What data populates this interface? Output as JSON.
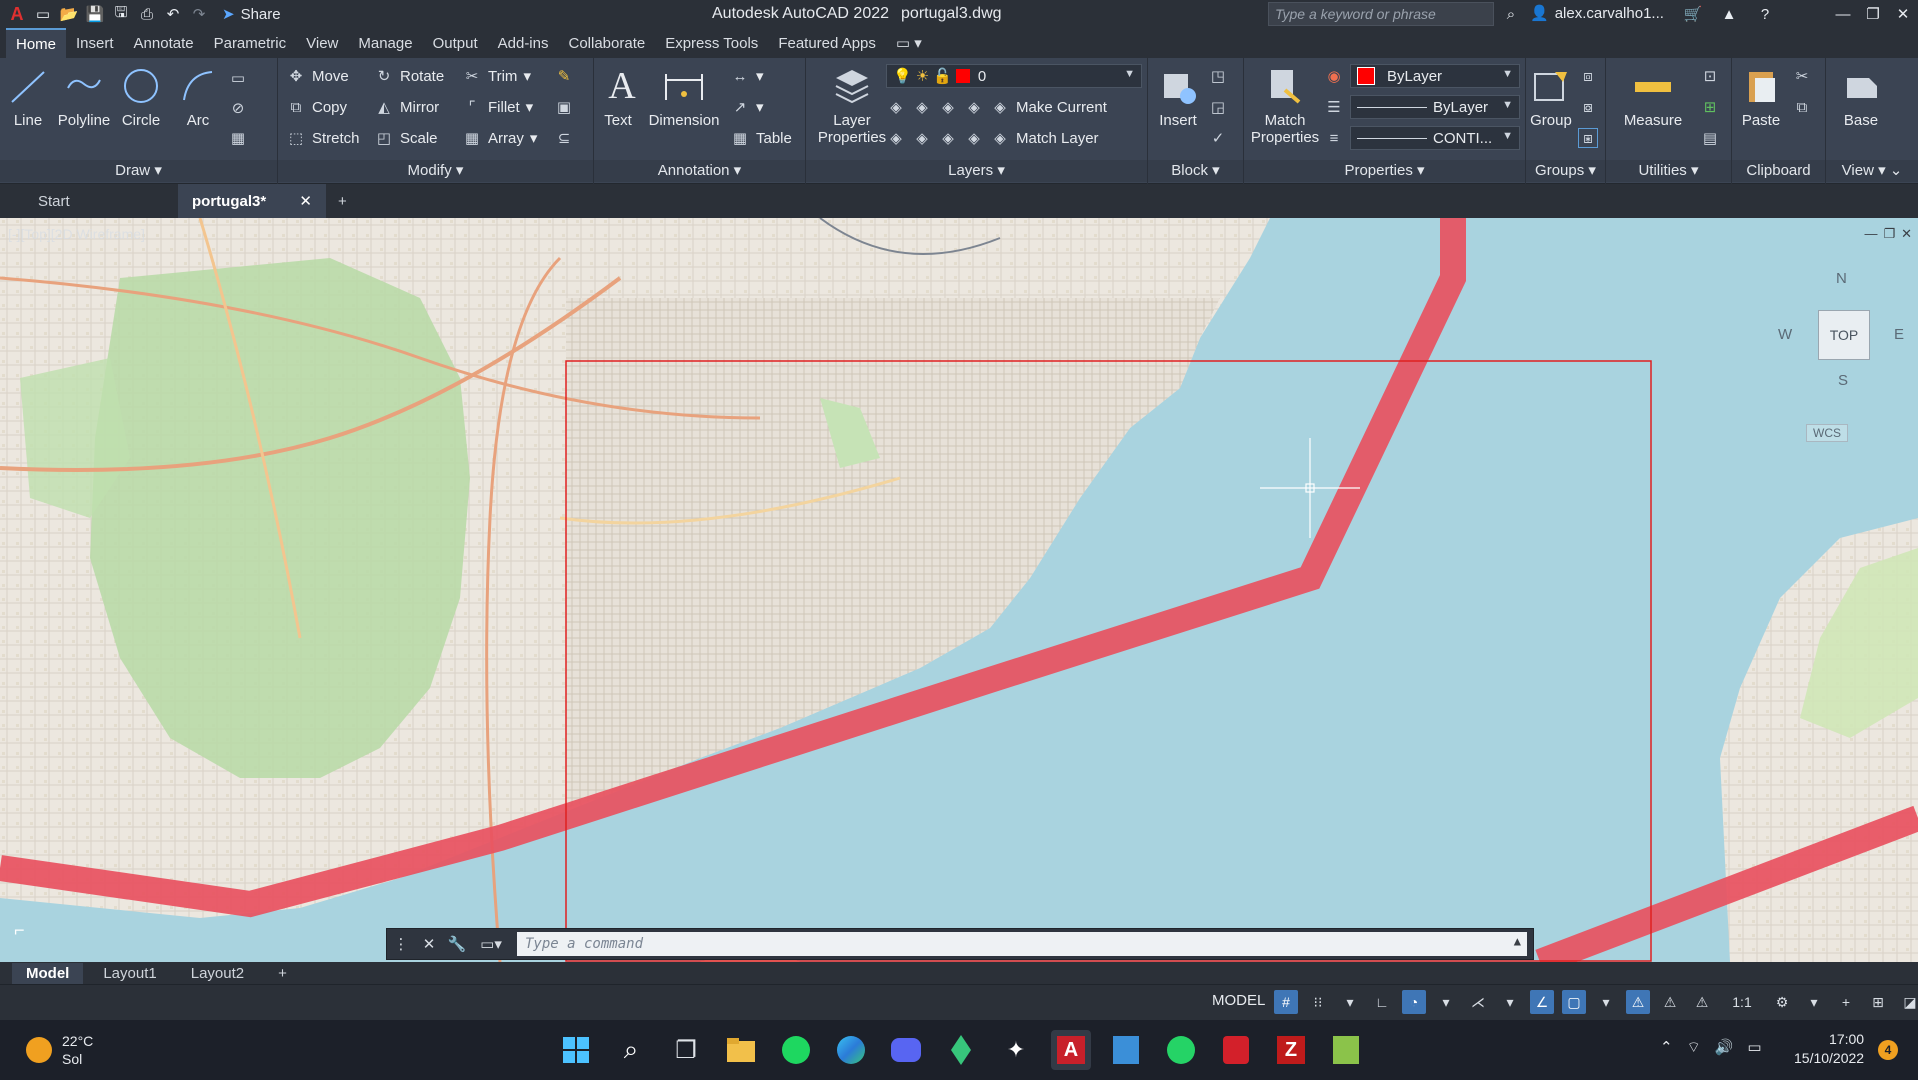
{
  "app": {
    "name": "Autodesk AutoCAD 2022",
    "file": "portugal3.dwg"
  },
  "titlebar": {
    "share_label": "Share",
    "search_placeholder": "Type a keyword or phrase",
    "user": "alex.carvalho1..."
  },
  "ribbon_tabs": [
    "Home",
    "Insert",
    "Annotate",
    "Parametric",
    "View",
    "Manage",
    "Output",
    "Add-ins",
    "Collaborate",
    "Express Tools",
    "Featured Apps"
  ],
  "draw": {
    "title": "Draw",
    "line": "Line",
    "polyline": "Polyline",
    "circle": "Circle",
    "arc": "Arc"
  },
  "modify": {
    "title": "Modify",
    "move": "Move",
    "rotate": "Rotate",
    "trim": "Trim",
    "copy": "Copy",
    "mirror": "Mirror",
    "fillet": "Fillet",
    "stretch": "Stretch",
    "scale": "Scale",
    "array": "Array"
  },
  "annotation": {
    "title": "Annotation",
    "text": "Text",
    "dimension": "Dimension",
    "table": "Table"
  },
  "layers": {
    "title": "Layers",
    "layer_properties_1": "Layer",
    "layer_properties_2": "Properties",
    "current_layer": "0",
    "make_current": "Make Current",
    "match_layer": "Match Layer"
  },
  "block": {
    "title": "Block",
    "insert": "Insert"
  },
  "properties": {
    "title": "Properties",
    "match_1": "Match",
    "match_2": "Properties",
    "color": "ByLayer",
    "lineweight": "ByLayer",
    "linetype": "CONTI..."
  },
  "groups": {
    "title": "Groups",
    "group": "Group"
  },
  "utilities": {
    "title": "Utilities",
    "measure": "Measure"
  },
  "clipboard": {
    "title": "Clipboard",
    "paste": "Paste"
  },
  "view": {
    "title": "View",
    "base": "Base"
  },
  "file_tabs": {
    "start": "Start",
    "active": "portugal3*"
  },
  "viewport": {
    "label": "[-][Top][2D Wireframe]",
    "cube_n": "N",
    "cube_s": "S",
    "cube_e": "E",
    "cube_w": "W",
    "cube_top": "TOP",
    "wcs": "WCS"
  },
  "command": {
    "placeholder": "Type a command"
  },
  "layout_tabs": [
    "Model",
    "Layout1",
    "Layout2"
  ],
  "status": {
    "model": "MODEL",
    "scale": "1:1"
  },
  "taskbar": {
    "temp": "22°C",
    "condition": "Sol",
    "time": "17:00",
    "date": "15/10/2022",
    "notifications": "4"
  },
  "colors": {
    "accent": "#5b9bd5",
    "layer_red": "#ff0000",
    "water": "#a9d3df",
    "ribbon": "#3b4453"
  }
}
